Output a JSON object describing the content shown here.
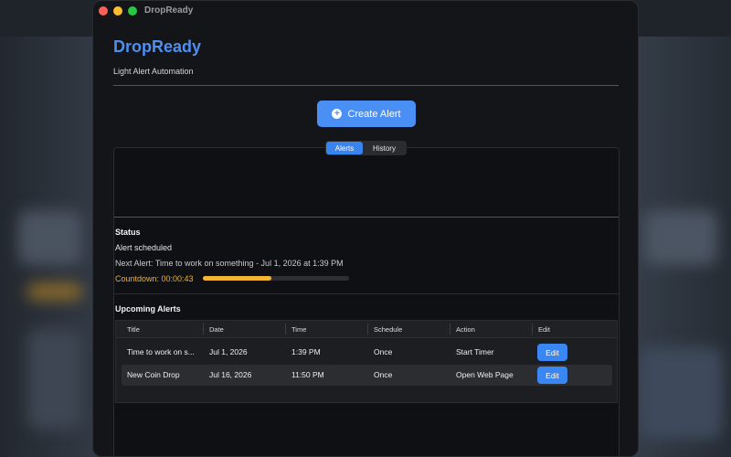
{
  "window": {
    "title": "DropReady"
  },
  "header": {
    "title": "DropReady",
    "subtitle": "Light Alert Automation"
  },
  "toolbar": {
    "create_label": "Create Alert",
    "create_icon": "plus-circle-icon"
  },
  "tabs": [
    {
      "label": "Alerts",
      "active": true
    },
    {
      "label": "History",
      "active": false
    }
  ],
  "status": {
    "heading": "Status",
    "state": "Alert scheduled",
    "next_alert": "Next Alert: Time to work on something - Jul 1, 2026 at 1:39 PM",
    "countdown": "Countdown: 00:00:43",
    "progress": 0.47
  },
  "upcoming": {
    "heading": "Upcoming Alerts",
    "columns": [
      "Title",
      "Date",
      "Time",
      "Schedule",
      "Action",
      "Edit"
    ],
    "rows": [
      {
        "title": "Time to work on s...",
        "date": "Jul 1, 2026",
        "time": "1:39 PM",
        "schedule": "Once",
        "action": "Start Timer",
        "edit": "Edit"
      },
      {
        "title": "New Coin Drop",
        "date": "Jul 16, 2026",
        "time": "11:50 PM",
        "schedule": "Once",
        "action": "Open Web Page",
        "edit": "Edit"
      }
    ]
  },
  "colors": {
    "accent": "#4a8ff4",
    "countdown": "#f2b536",
    "title": "#4e8ff0"
  }
}
